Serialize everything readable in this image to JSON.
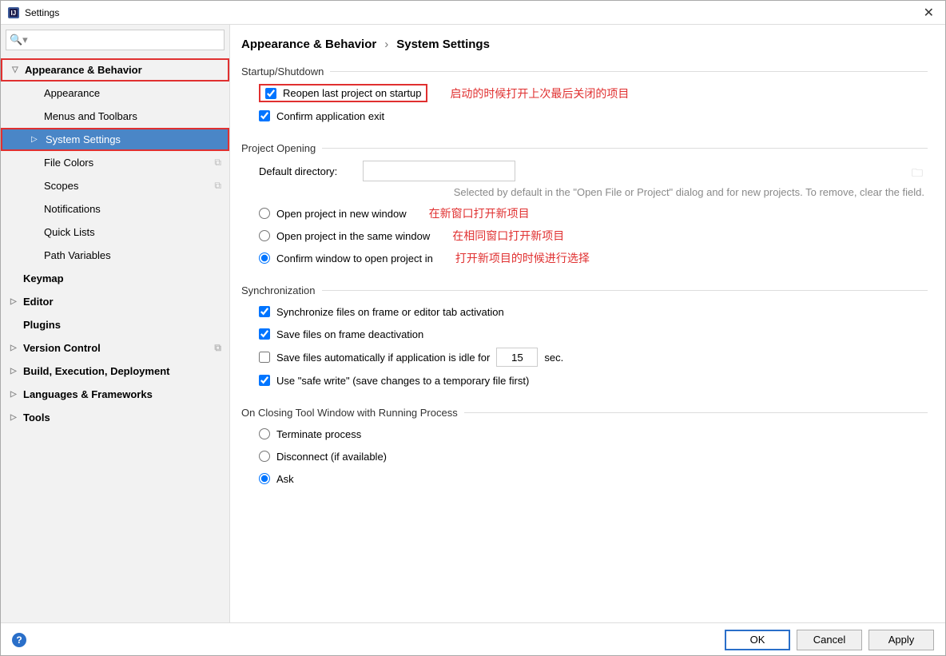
{
  "window": {
    "title": "Settings"
  },
  "search": {
    "placeholder": ""
  },
  "sidebar": {
    "items": [
      {
        "label": "Appearance & Behavior",
        "level": 0,
        "bold": true,
        "expanded": true,
        "redbox": true
      },
      {
        "label": "Appearance",
        "level": 1
      },
      {
        "label": "Menus and Toolbars",
        "level": 1
      },
      {
        "label": "System Settings",
        "level": 1,
        "selected": true,
        "hasChildren": true,
        "redbox": true
      },
      {
        "label": "File Colors",
        "level": 1,
        "copy": true
      },
      {
        "label": "Scopes",
        "level": 1,
        "copy": true
      },
      {
        "label": "Notifications",
        "level": 1
      },
      {
        "label": "Quick Lists",
        "level": 1
      },
      {
        "label": "Path Variables",
        "level": 1
      },
      {
        "label": "Keymap",
        "level": 0,
        "bold": true
      },
      {
        "label": "Editor",
        "level": 0,
        "bold": true,
        "hasChildren": true
      },
      {
        "label": "Plugins",
        "level": 0,
        "bold": true
      },
      {
        "label": "Version Control",
        "level": 0,
        "bold": true,
        "hasChildren": true,
        "copy": true
      },
      {
        "label": "Build, Execution, Deployment",
        "level": 0,
        "bold": true,
        "hasChildren": true
      },
      {
        "label": "Languages & Frameworks",
        "level": 0,
        "bold": true,
        "hasChildren": true
      },
      {
        "label": "Tools",
        "level": 0,
        "bold": true,
        "hasChildren": true
      }
    ]
  },
  "breadcrumb": {
    "a": "Appearance & Behavior",
    "sep": "›",
    "b": "System Settings"
  },
  "sections": {
    "startup": {
      "title": "Startup/Shutdown",
      "reopen": "Reopen last project on startup",
      "reopen_note": "启动的时候打开上次最后关闭的项目",
      "confirm_exit": "Confirm application exit"
    },
    "project_opening": {
      "title": "Project Opening",
      "default_dir_label": "Default directory:",
      "default_dir_value": "",
      "hint": "Selected by default in the \"Open File or Project\" dialog and for new projects. To remove, clear the field.",
      "opt_new": "Open project in new window",
      "opt_new_note": "在新窗口打开新项目",
      "opt_same": "Open project in the same window",
      "opt_same_note": "在相同窗口打开新项目",
      "opt_confirm": "Confirm window to open project in",
      "opt_confirm_note": "打开新项目的时候进行选择"
    },
    "sync": {
      "title": "Synchronization",
      "sync_frame": "Synchronize files on frame or editor tab activation",
      "save_deact": "Save files on frame deactivation",
      "save_idle": "Save files automatically if application is idle for",
      "save_idle_value": "15",
      "save_idle_unit": "sec.",
      "safe_write": "Use \"safe write\" (save changes to a temporary file first)"
    },
    "closing": {
      "title": "On Closing Tool Window with Running Process",
      "terminate": "Terminate process",
      "disconnect": "Disconnect (if available)",
      "ask": "Ask"
    }
  },
  "footer": {
    "ok": "OK",
    "cancel": "Cancel",
    "apply": "Apply"
  }
}
